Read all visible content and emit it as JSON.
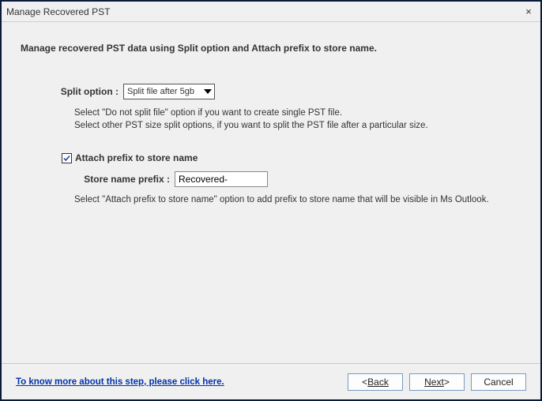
{
  "titlebar": {
    "title": "Manage Recovered PST",
    "close": "×"
  },
  "heading": "Manage recovered PST data using Split option and Attach prefix to store name.",
  "split": {
    "label": "Split option :",
    "value": "Split file after 5gb",
    "help1": "Select \"Do not split file\" option if you want to create single PST file.",
    "help2": "Select other PST size split options, if you want to split the PST file after a particular size."
  },
  "prefix": {
    "checkbox_label": "Attach prefix to store name",
    "checked": true,
    "field_label": "Store name prefix :",
    "value": "Recovered-",
    "help": "Select \"Attach prefix to store name\" option to add prefix to store name that will be visible in Ms Outlook."
  },
  "footer": {
    "link": "To know more about this step, please click here.",
    "back": "Back",
    "next": "Next",
    "cancel": "Cancel"
  }
}
